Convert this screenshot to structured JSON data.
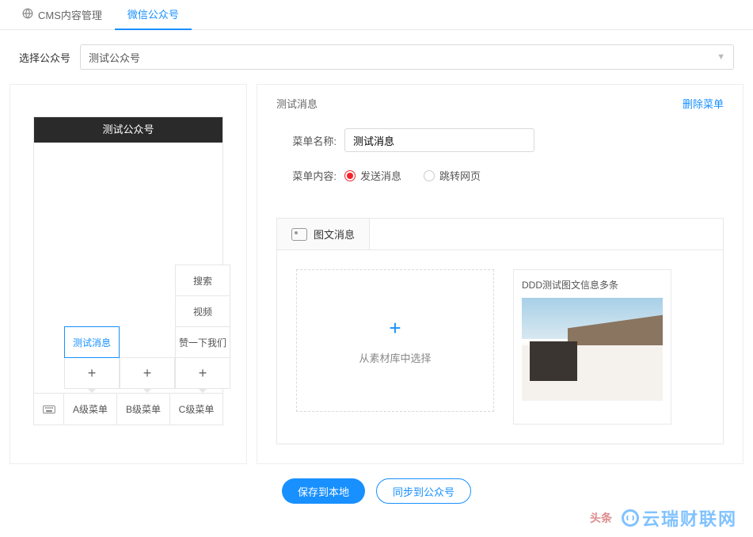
{
  "tabs": {
    "cms": "CMS内容管理",
    "wechat": "微信公众号"
  },
  "selector": {
    "label": "选择公众号",
    "value": "测试公众号"
  },
  "phone": {
    "title": "测试公众号",
    "main_menus": [
      "A级菜单",
      "B级菜单",
      "C级菜单"
    ],
    "col_a": {
      "selected": "测试消息",
      "plus": "+"
    },
    "col_b": {
      "plus": "+"
    },
    "col_c": {
      "items": [
        "搜索",
        "视频",
        "赞一下我们"
      ],
      "plus": "+"
    }
  },
  "detail": {
    "title": "测试消息",
    "delete": "删除菜单",
    "name_label": "菜单名称:",
    "name_value": "测试消息",
    "content_label": "菜单内容:",
    "radio_send": "发送消息",
    "radio_jump": "跳转网页",
    "tab_tuwen": "图文消息",
    "picker_text": "从素材库中选择",
    "card_title": "DDD测试图文信息多条"
  },
  "footer": {
    "save": "保存到本地",
    "sync": "同步到公众号"
  },
  "watermark": {
    "left": "头条",
    "right": "云瑞财联网"
  }
}
